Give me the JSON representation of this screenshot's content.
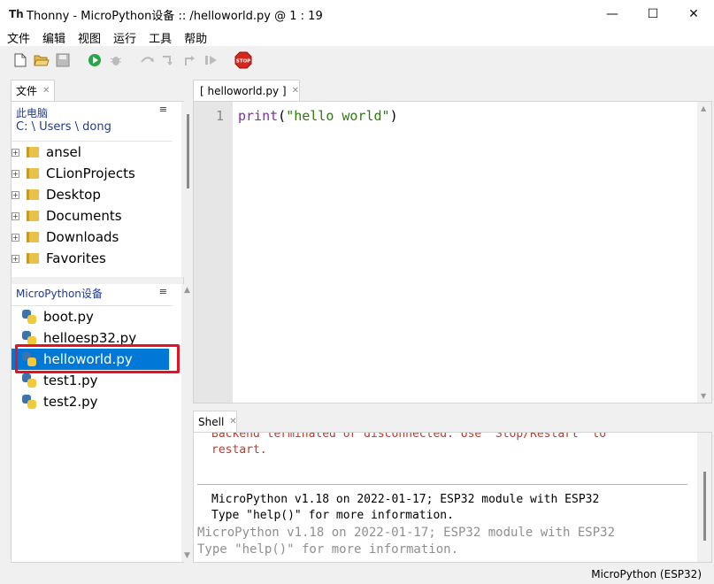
{
  "window": {
    "title": "Thonny  -  MicroPython设备 :: /helloworld.py  @  1 : 19",
    "controls": [
      "—",
      "☐",
      "✕"
    ]
  },
  "menu": [
    "文件",
    "编辑",
    "视图",
    "运行",
    "工具",
    "帮助"
  ],
  "toolbar": {
    "buttons": [
      "new-file",
      "open-file",
      "save-file",
      "run",
      "debug",
      "step-over",
      "step-into",
      "step-out",
      "resume",
      "stop"
    ],
    "stop_label": "STOP"
  },
  "files": {
    "tab_label": "文件",
    "computer": {
      "title": "此电脑",
      "path": "C: \\ Users \\ dong",
      "items": [
        "ansel",
        "CLionProjects",
        "Desktop",
        "Documents",
        "Downloads",
        "Favorites"
      ]
    },
    "device": {
      "title": "MicroPython设备",
      "items": [
        "boot.py",
        "helloesp32.py",
        "helloworld.py",
        "test1.py",
        "test2.py"
      ],
      "selected": "helloworld.py"
    },
    "menu_glyph": "≡"
  },
  "editor": {
    "tab_label": "[ helloworld.py ]",
    "line_number": "1",
    "code": {
      "keyword": "print",
      "open": "(",
      "string": "\"hello world\"",
      "close": ")"
    }
  },
  "shell": {
    "tab_label": "Shell",
    "lines": [
      "Backend terminated or disconnected. Use 'Stop/Restart' to",
      "restart.",
      "MicroPython v1.18 on 2022-01-17; ESP32 module with ESP32",
      "Type \"help()\" for more information.",
      "MicroPython v1.18 on 2022-01-17; ESP32 module with ESP32",
      "Type \"help()\" for more information."
    ]
  },
  "status": {
    "interpreter": "MicroPython (ESP32)"
  }
}
